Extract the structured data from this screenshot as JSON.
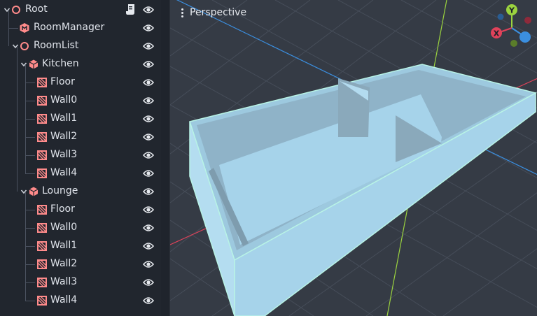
{
  "scene_tree": {
    "nodes": [
      {
        "label": "Root",
        "icon": "node-circle-icon",
        "has_script": true
      },
      {
        "label": "RoomManager",
        "icon": "room-manager-icon",
        "has_script": false
      },
      {
        "label": "RoomList",
        "icon": "node-circle-icon",
        "has_script": false
      },
      {
        "label": "Kitchen",
        "icon": "room-cube-icon",
        "has_script": false
      },
      {
        "label": "Floor",
        "icon": "geometry-icon",
        "has_script": false
      },
      {
        "label": "Wall0",
        "icon": "geometry-icon",
        "has_script": false
      },
      {
        "label": "Wall1",
        "icon": "geometry-icon",
        "has_script": false
      },
      {
        "label": "Wall2",
        "icon": "geometry-icon",
        "has_script": false
      },
      {
        "label": "Wall3",
        "icon": "geometry-icon",
        "has_script": false
      },
      {
        "label": "Wall4",
        "icon": "geometry-icon",
        "has_script": false
      },
      {
        "label": "Lounge",
        "icon": "room-cube-icon",
        "has_script": false
      },
      {
        "label": "Floor",
        "icon": "geometry-icon",
        "has_script": false
      },
      {
        "label": "Wall0",
        "icon": "geometry-icon",
        "has_script": false
      },
      {
        "label": "Wall1",
        "icon": "geometry-icon",
        "has_script": false
      },
      {
        "label": "Wall2",
        "icon": "geometry-icon",
        "has_script": false
      },
      {
        "label": "Wall3",
        "icon": "geometry-icon",
        "has_script": false
      },
      {
        "label": "Wall4",
        "icon": "geometry-icon",
        "has_script": false
      }
    ]
  },
  "viewport": {
    "menu_label": "Perspective",
    "gizmo": {
      "y_label": "Y",
      "x_label": "X"
    }
  },
  "colors": {
    "node_icon": "#ff8b8b",
    "eye_icon": "#e6e9ee",
    "axis_x": "#e0425a",
    "axis_y": "#9bd33f",
    "axis_z": "#3b8fe0",
    "mesh_fill": "#a6d3ea",
    "mesh_edge": "#b8f3e6"
  }
}
